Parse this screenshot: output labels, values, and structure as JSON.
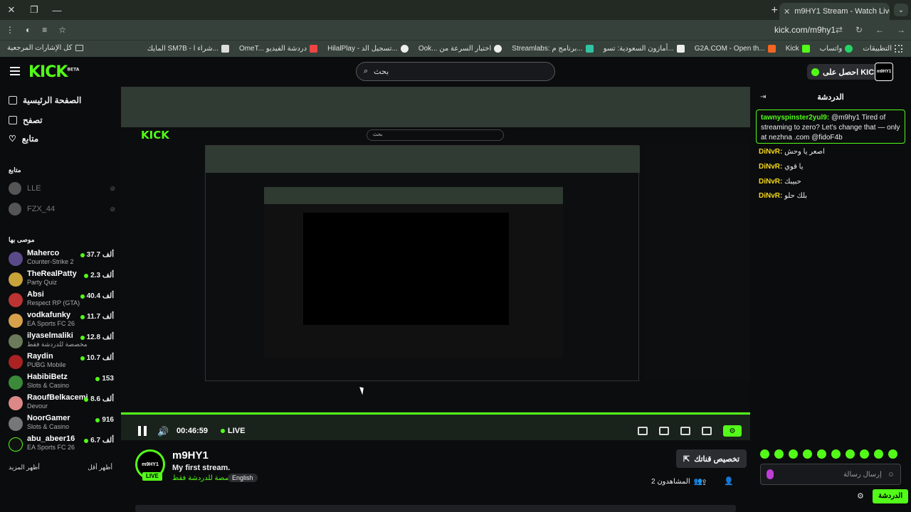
{
  "browser": {
    "tab_title": "m9HY1 Stream - Watch Live",
    "url": "kick.com/m9hy1",
    "bookmarks": [
      "التطبيقات",
      "واتساب",
      "Kick",
      "G2A.COM - Open th...",
      "أمازون السعودية: تسو...",
      "Streamlabs: برنامج م...",
      "Ook... اختبار السرعة من",
      "HilalPlay - تسجيل الد...",
      "OmeT... دردشة الفيديو",
      "المايك SM7B - شراء ا..."
    ],
    "all_bookmarks": "كل الإشارات المرجعية"
  },
  "header": {
    "logo": "KICK",
    "logo_beta": "BETA",
    "search_placeholder": "بحث",
    "get_kicks": "احصل على KICKs",
    "avatar_text": "m9HY1"
  },
  "sidebar": {
    "nav": [
      "الصفحة الرئيسية",
      "تصفح",
      "متابع"
    ],
    "following_title": "متابع",
    "following": [
      {
        "name": "LLE"
      },
      {
        "name": "FZX_44"
      }
    ],
    "recommended_title": "موصى بها",
    "recommended": [
      {
        "name": "Maherco",
        "game": "Counter-Strike 2",
        "viewers": "37.7 ألف"
      },
      {
        "name": "TheRealPatty",
        "game": "Party Quiz",
        "viewers": "2.3 ألف"
      },
      {
        "name": "Absi",
        "game": "Respect RP (GTA)",
        "viewers": "40.4 ألف"
      },
      {
        "name": "vodkafunky",
        "game": "EA Sports FC 26",
        "viewers": "11.7 ألف"
      },
      {
        "name": "ilyaselmaliki",
        "game": "مخصصة للدردشة فقط",
        "viewers": "12.8 ألف"
      },
      {
        "name": "Raydin",
        "game": "PUBG Mobile",
        "viewers": "10.7 ألف"
      },
      {
        "name": "HabibiBetz",
        "game": "Slots & Casino",
        "viewers": "153"
      },
      {
        "name": "RaoufBelkacemi",
        "game": "Devour",
        "viewers": "8.6 ألف"
      },
      {
        "name": "NoorGamer",
        "game": "Slots & Casino",
        "viewers": "916"
      },
      {
        "name": "abu_abeer16",
        "game": "EA Sports FC 26",
        "viewers": "6.7 ألف"
      }
    ],
    "show_more": "أظهر المزيد",
    "show_less": "أظهر أقل"
  },
  "player": {
    "time": "00:46:59",
    "live": "LIVE"
  },
  "channel": {
    "name": "m9HY1",
    "avatar_text": "m9HY1",
    "live_badge": "LIVE",
    "title": "My first stream.",
    "category": "مخصصة للدردشة فقط",
    "language": "English",
    "customize": "تخصيص قناتك",
    "viewers": "المشاهدون 2"
  },
  "chat": {
    "title": "الدردشة",
    "pinned_user": "tawnyspinster2yul9:",
    "pinned_text": "@m9hy1 Tired of streaming to zero? Let’s change that — only at nezhna .com @fidoF4b",
    "messages": [
      {
        "user": "DiNvR:",
        "text": "اصعر يا وحش"
      },
      {
        "user": "DiNvR:",
        "text": "يا قوي"
      },
      {
        "user": "DiNvR:",
        "text": "حبيبك"
      },
      {
        "user": "DiNvR:",
        "text": "بلك حلو"
      }
    ],
    "input_placeholder": "إرسال رسالة",
    "send": "الدردشة"
  },
  "colors": {
    "accent": "#53fc18",
    "background": "#0b0c0e",
    "chrome": "#35413a"
  }
}
